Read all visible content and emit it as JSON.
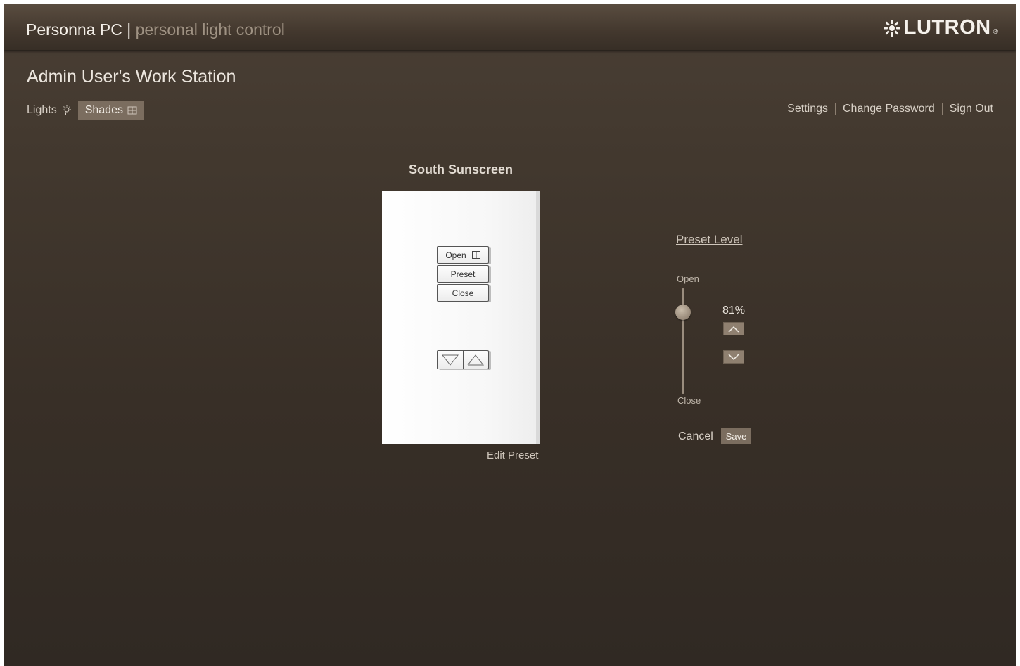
{
  "header": {
    "app_name": "Personna PC",
    "separator": "|",
    "app_subtitle": "personal light control",
    "logo_text": "LUTRON",
    "logo_mark": "®",
    "logo_icon": "sunburst-icon"
  },
  "page": {
    "title": "Admin User's Work Station"
  },
  "tabs": [
    {
      "label": "Lights",
      "icon": "lightbulb-icon",
      "active": false
    },
    {
      "label": "Shades",
      "icon": "shade-icon",
      "active": true
    }
  ],
  "top_links": [
    "Settings",
    "Change Password",
    "Sign Out"
  ],
  "device": {
    "name": "South Sunscreen",
    "buttons": [
      {
        "label": "Open",
        "icon": "shade-icon"
      },
      {
        "label": "Preset"
      },
      {
        "label": "Close"
      }
    ],
    "raise_lower": [
      "lower-arrow-icon",
      "raise-arrow-icon"
    ],
    "edit_link": "Edit Preset"
  },
  "preset": {
    "title": "Preset Level",
    "open_label": "Open",
    "close_label": "Close",
    "level_text": "81%",
    "level_value": 81,
    "cancel_label": "Cancel",
    "save_label": "Save"
  }
}
